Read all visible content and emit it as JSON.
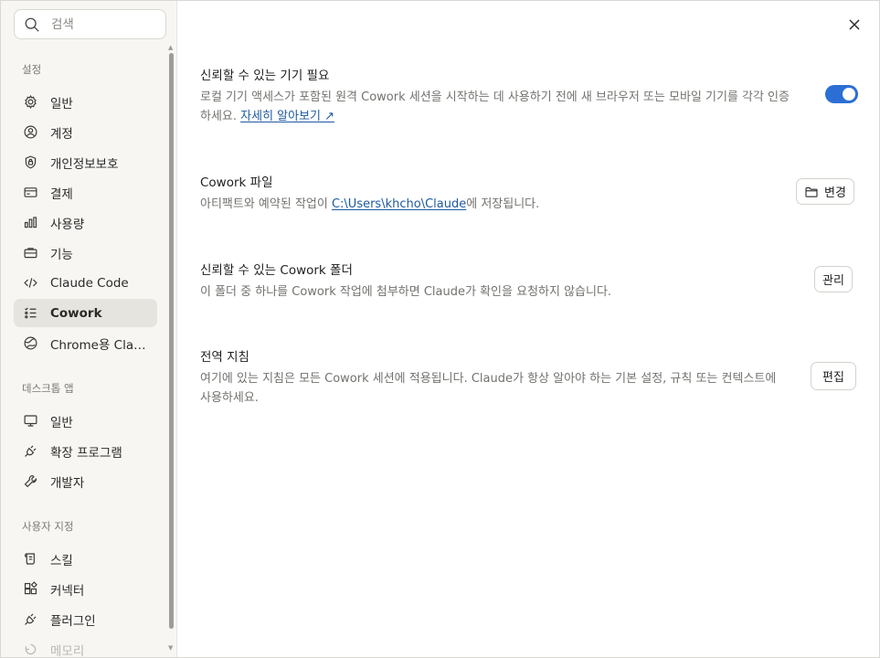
{
  "search": {
    "placeholder": "검색"
  },
  "sidebar": {
    "sections": [
      {
        "label": "설정",
        "items": [
          {
            "label": "일반",
            "icon": "gear-icon"
          },
          {
            "label": "계정",
            "icon": "user-circle-icon"
          },
          {
            "label": "개인정보보호",
            "icon": "shield-lock-icon"
          },
          {
            "label": "결제",
            "icon": "credit-card-icon"
          },
          {
            "label": "사용량",
            "icon": "bar-chart-icon"
          },
          {
            "label": "기능",
            "icon": "briefcase-icon"
          },
          {
            "label": "Claude Code",
            "icon": "code-icon"
          },
          {
            "label": "Cowork",
            "icon": "checklist-icon",
            "active": true
          },
          {
            "label": "Chrome용 Cla…",
            "icon": "globe-icon"
          }
        ]
      },
      {
        "label": "데스크톱 앱",
        "items": [
          {
            "label": "일반",
            "icon": "monitor-icon"
          },
          {
            "label": "확장 프로그램",
            "icon": "plug-icon"
          },
          {
            "label": "개발자",
            "icon": "wrench-icon"
          }
        ]
      },
      {
        "label": "사용자 지정",
        "items": [
          {
            "label": "스킬",
            "icon": "scroll-icon"
          },
          {
            "label": "커넥터",
            "icon": "connector-icon"
          },
          {
            "label": "플러그인",
            "icon": "plug-icon"
          },
          {
            "label": "메모리",
            "icon": "memory-icon"
          }
        ]
      }
    ]
  },
  "settings": {
    "trusted_device": {
      "title": "신뢰할 수 있는 기기 필요",
      "desc": "로컬 기기 액세스가 포함된 원격 Cowork 세션을 시작하는 데 사용하기 전에 새 브라우저 또는 모바일 기기를 각각 인증하세요.",
      "link": "자세히 알아보기 ↗",
      "enabled": true
    },
    "cowork_files": {
      "title": "Cowork 파일",
      "desc_before": "아티팩트와 예약된 작업이 ",
      "path": "C:\\Users\\khcho\\Claude",
      "desc_after": "에 저장됩니다.",
      "button": "변경"
    },
    "trusted_folders": {
      "title": "신뢰할 수 있는 Cowork 폴더",
      "desc": "이 폴더 중 하나를 Cowork 작업에 첨부하면 Claude가 확인을 요청하지 않습니다.",
      "button": "관리"
    },
    "global_instructions": {
      "title": "전역 지침",
      "desc": "여기에 있는 지침은 모든 Cowork 세션에 적용됩니다. Claude가 항상 알아야 하는 기본 설정, 규칙 또는 컨텍스트에 사용하세요.",
      "button": "편집"
    }
  },
  "colors": {
    "accent": "#2b6fd6",
    "link": "#1e5aa0",
    "active_bg": "#e6e4df"
  }
}
